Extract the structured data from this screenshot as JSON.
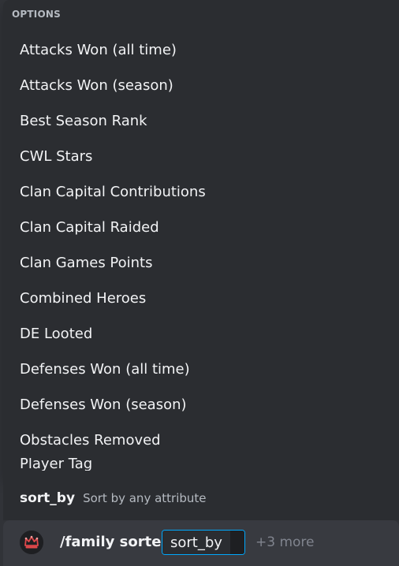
{
  "autocomplete": {
    "header": "OPTIONS",
    "options": [
      "Attacks Won (all time)",
      "Attacks Won (season)",
      "Best Season Rank",
      "CWL Stars",
      "Clan Capital Contributions",
      "Clan Capital Raided",
      "Clan Games Points",
      "Combined Heroes",
      "DE Looted",
      "Defenses Won (all time)",
      "Defenses Won (season)",
      "Obstacles Removed"
    ],
    "clipped_option": "Player Tag"
  },
  "parameter": {
    "name": "sort_by",
    "description": "Sort by any attribute"
  },
  "command_bar": {
    "command": "/family sorted",
    "option_label": "sort_by",
    "more": "+3 more",
    "bot_avatar_icon": "crown-icon",
    "accent_color": "#00a8fc"
  }
}
